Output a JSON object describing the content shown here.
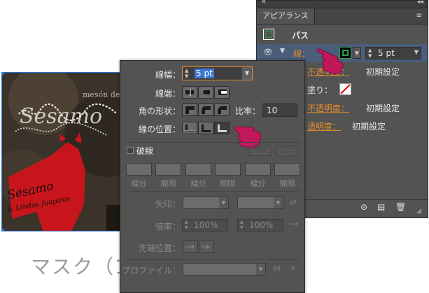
{
  "mask_label": "マスク（1",
  "artwork": {
    "sign_text_1": "mesón de",
    "sign_text_2": "Sesamo",
    "sign_text_3": "Sesamo",
    "sign_text_4": "& Lindos Juapiros"
  },
  "appearance": {
    "title": "アピアランス",
    "object_label": "パス",
    "stroke_label": "線：",
    "stroke_weight": "5 pt",
    "rows": [
      {
        "label": "不透明度：",
        "value": "初期設定"
      },
      {
        "label": "塗り："
      },
      {
        "label": "不透明度：",
        "value": "初期設定"
      },
      {
        "label": "透明度：",
        "value": "初期設定"
      }
    ]
  },
  "stroke_panel": {
    "weight_label": "線幅：",
    "weight_value": "5 pt",
    "cap_label": "線端：",
    "corner_label": "角の形状：",
    "limit_label": "比率：",
    "limit_value": "10",
    "align_label": "線の位置：",
    "dashed_label": "破線",
    "dash_labels": [
      "線分",
      "間隔",
      "線分",
      "間隔",
      "線分",
      "間隔"
    ],
    "arrow_label": "矢印：",
    "scale_label": "倍率：",
    "scale_value_1": "100%",
    "scale_value_2": "100%",
    "tip_label": "先端位置：",
    "profile_label": "プロファイル："
  },
  "colors": {
    "panel_bg": "#535353",
    "accent_orange": "#e08b2a",
    "pointer_magenta": "#c2185b",
    "selection_blue": "#2a78d6"
  }
}
